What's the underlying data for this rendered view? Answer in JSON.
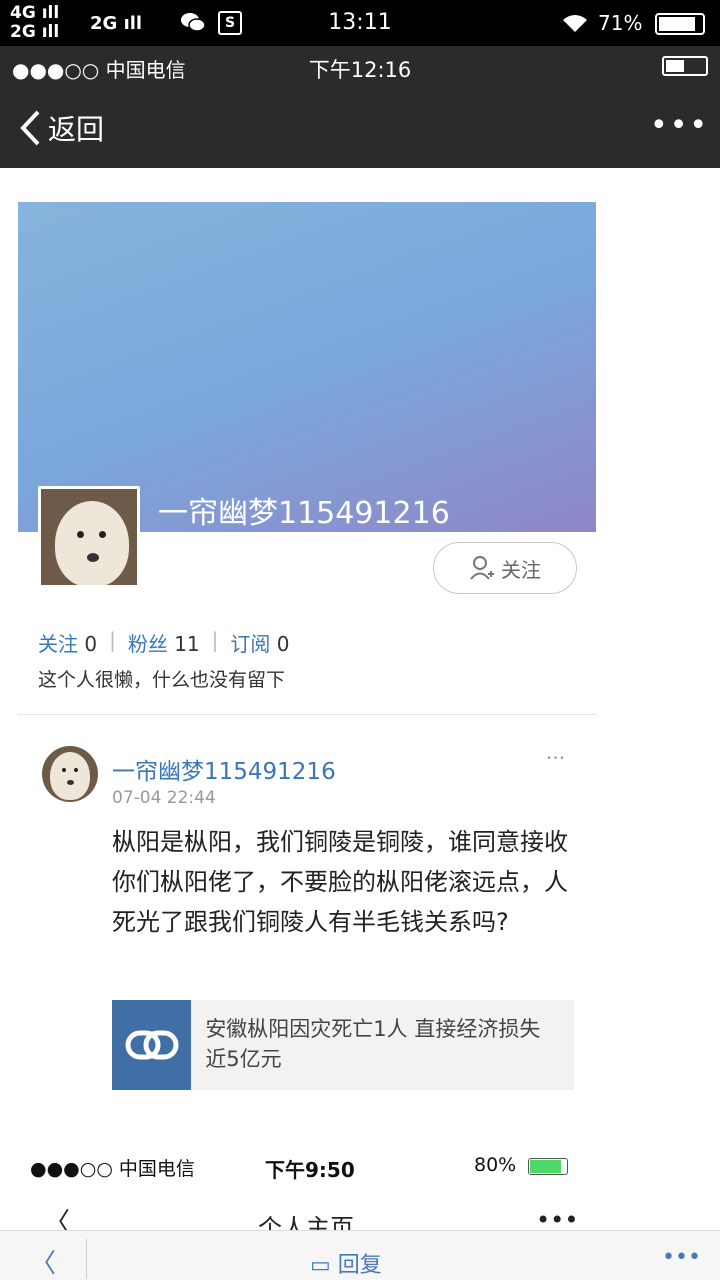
{
  "device_status": {
    "signal_primary": "4G",
    "signal_secondary": "2G",
    "signal_third": "2G",
    "time": "13:11",
    "battery": "71%"
  },
  "inner_status": {
    "carrier": "●●●○○ 中国电信",
    "time": "下午12:16"
  },
  "nav": {
    "back_label": "返回",
    "more_label": "•••"
  },
  "profile": {
    "username": "一帘幽梦115491216",
    "follow_label": "关注",
    "stats": [
      {
        "label": "关注",
        "value": "0"
      },
      {
        "label": "粉丝",
        "value": "11"
      },
      {
        "label": "订阅",
        "value": "0"
      }
    ],
    "bio": "这个人很懒，什么也没有留下"
  },
  "post": {
    "username": "一帘幽梦115491216",
    "date": "07-04 22:44",
    "more": "···",
    "text": "枞阳是枞阳，我们铜陵是铜陵，谁同意接收你们枞阳佬了，不要脸的枞阳佬滚远点，人死光了跟我们铜陵人有半毛钱关系吗?",
    "link_title": "安徽枞阳因灾死亡1人 直接经济损失近5亿元"
  },
  "second_screenshot": {
    "carrier": "●●●○○ 中国电信",
    "time": "下午9:50",
    "battery": "80%",
    "back": "〈",
    "title": "个人主页",
    "more": "•••"
  },
  "bottom_bar": {
    "back": "〈",
    "reply": "回复",
    "more": "•••"
  }
}
